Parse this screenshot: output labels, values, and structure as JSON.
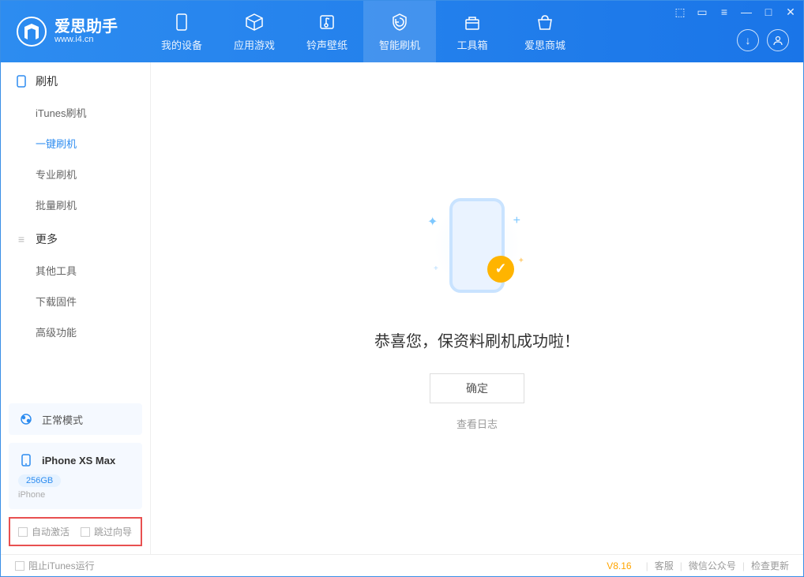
{
  "app": {
    "name": "爱思助手",
    "url": "www.i4.cn"
  },
  "nav": [
    {
      "label": "我的设备"
    },
    {
      "label": "应用游戏"
    },
    {
      "label": "铃声壁纸"
    },
    {
      "label": "智能刷机"
    },
    {
      "label": "工具箱"
    },
    {
      "label": "爱思商城"
    }
  ],
  "sidebar": {
    "section1_title": "刷机",
    "section1_items": [
      "iTunes刷机",
      "一键刷机",
      "专业刷机",
      "批量刷机"
    ],
    "section2_title": "更多",
    "section2_items": [
      "其他工具",
      "下载固件",
      "高级功能"
    ],
    "mode": "正常模式",
    "device": {
      "name": "iPhone XS Max",
      "storage": "256GB",
      "type": "iPhone"
    },
    "options": [
      "自动激活",
      "跳过向导"
    ]
  },
  "main": {
    "success_msg": "恭喜您，保资料刷机成功啦！",
    "ok_btn": "确定",
    "log_link": "查看日志"
  },
  "footer": {
    "block_itunes": "阻止iTunes运行",
    "version": "V8.16",
    "links": [
      "客服",
      "微信公众号",
      "检查更新"
    ]
  }
}
